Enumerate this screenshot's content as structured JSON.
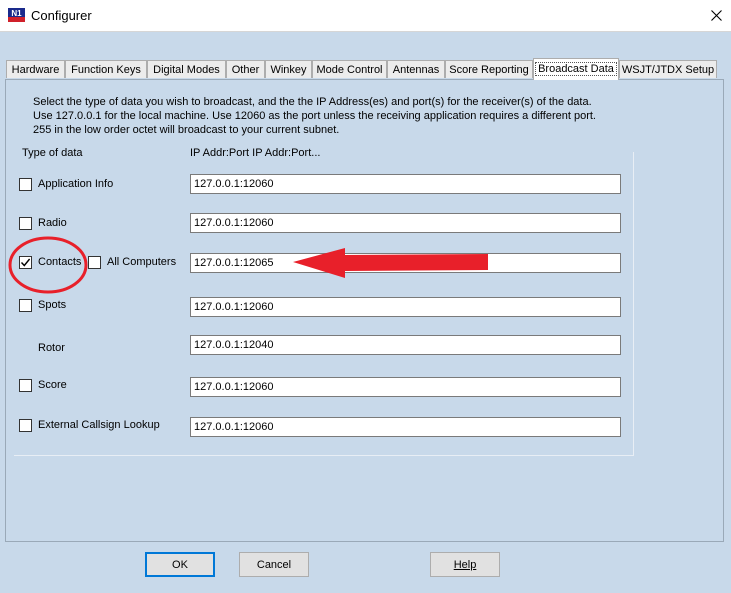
{
  "window": {
    "title": "Configurer",
    "icon_text": "N1",
    "close_glyph": "✕"
  },
  "tabs": [
    {
      "label": "Hardware",
      "active": false
    },
    {
      "label": "Function Keys",
      "active": false
    },
    {
      "label": "Digital Modes",
      "active": false
    },
    {
      "label": "Other",
      "active": false
    },
    {
      "label": "Winkey",
      "active": false
    },
    {
      "label": "Mode Control",
      "active": false
    },
    {
      "label": "Antennas",
      "active": false
    },
    {
      "label": "Score Reporting",
      "active": false
    },
    {
      "label": "Broadcast Data",
      "active": true
    },
    {
      "label": "WSJT/JTDX Setup",
      "active": false
    }
  ],
  "help_lines": [
    "Select the type of data you wish to broadcast, and the the IP Address(es) and port(s) for the receiver(s) of the data.",
    "Use 127.0.0.1 for the local machine.  Use 12060 as the port unless the receiving application requires a different port.",
    "255 in the low order octet will broadcast to your current subnet."
  ],
  "columns": {
    "type": "Type of data",
    "ip": "IP Addr:Port IP Addr:Port..."
  },
  "rows": [
    {
      "label": "Application Info",
      "checked": false,
      "value": "127.0.0.1:12060"
    },
    {
      "label": "Radio",
      "checked": false,
      "value": "127.0.0.1:12060"
    },
    {
      "label": "Contacts",
      "checked": true,
      "value": "127.0.0.1:12065",
      "extra_label": "All Computers",
      "extra_checked": false
    },
    {
      "label": "Spots",
      "checked": false,
      "value": "127.0.0.1:12060"
    },
    {
      "label": "Rotor",
      "has_checkbox": false,
      "value": "127.0.0.1:12040"
    },
    {
      "label": "Score",
      "checked": false,
      "value": "127.0.0.1:12060"
    },
    {
      "label": "External Callsign Lookup",
      "checked": false,
      "value": "127.0.0.1:12060"
    }
  ],
  "buttons": {
    "ok": "OK",
    "cancel": "Cancel",
    "help": "Help"
  },
  "annotation": {
    "color": "#e8202a"
  }
}
